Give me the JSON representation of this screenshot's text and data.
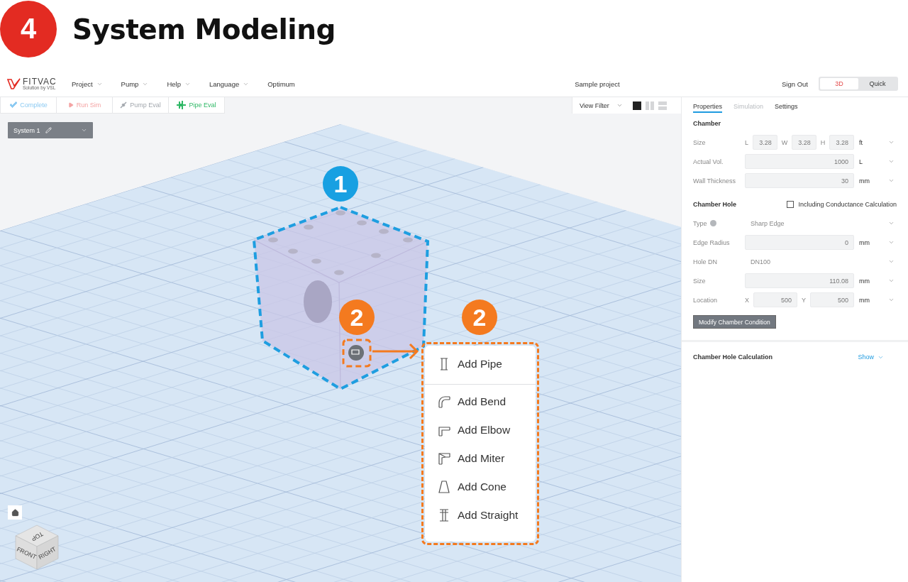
{
  "header": {
    "step": "4",
    "title": "System Modeling"
  },
  "navbar": {
    "logo": {
      "name": "FITVAC",
      "tagline": "Solution by VSL"
    },
    "menu": [
      {
        "label": "Project",
        "dropdown": true
      },
      {
        "label": "Pump",
        "dropdown": true
      },
      {
        "label": "Help",
        "dropdown": true
      },
      {
        "label": "Language",
        "dropdown": true
      },
      {
        "label": "Optimum",
        "dropdown": false
      }
    ],
    "project_name": "Sample project",
    "sign_out": "Sign Out",
    "mode_toggle": [
      {
        "label": "3D",
        "selected": true
      },
      {
        "label": "Quick",
        "selected": false
      }
    ]
  },
  "toolbar": [
    {
      "label": "Complete",
      "kind": "check",
      "color": "#8ccaf2"
    },
    {
      "label": "Run Sim",
      "kind": "play",
      "color": "#f4a3a3"
    },
    {
      "label": "Pump Eval",
      "kind": "pump",
      "color": "#a3a8ae"
    },
    {
      "label": "Pipe Eval",
      "kind": "wave",
      "color": "#2fb866"
    }
  ],
  "view_filter": {
    "label": "View Filter",
    "layouts": [
      {
        "kind": "single",
        "selected": true
      },
      {
        "kind": "columns",
        "selected": false
      },
      {
        "kind": "rows",
        "selected": false
      }
    ]
  },
  "system_selector": {
    "label": "System 1"
  },
  "viewport": {
    "badges": [
      {
        "text": "1",
        "color": "#18a0e2"
      },
      {
        "text": "2",
        "color": "#f47a1f"
      },
      {
        "text": "2",
        "color": "#f47a1f"
      }
    ],
    "context_menu": [
      {
        "label": "Add Pipe",
        "kind": "pipe"
      },
      {
        "label": "Add Bend",
        "kind": "bend"
      },
      {
        "label": "Add Elbow",
        "kind": "elbow"
      },
      {
        "label": "Add Miter",
        "kind": "miter"
      },
      {
        "label": "Add Cone",
        "kind": "cone"
      },
      {
        "label": "Add Straight",
        "kind": "straight"
      }
    ],
    "view_cube": {
      "top": "TOP",
      "front": "FRONT",
      "right": "RIGHT"
    }
  },
  "panel": {
    "tabs": [
      {
        "label": "Properties",
        "selected": true,
        "disabled": false
      },
      {
        "label": "Simulation",
        "selected": false,
        "disabled": true
      },
      {
        "label": "Settings",
        "selected": false,
        "disabled": false
      }
    ],
    "chamber": {
      "title": "Chamber",
      "rows": [
        {
          "kind": "triple",
          "label": "Size",
          "fields": [
            {
              "prefix": "L",
              "value": "3.28"
            },
            {
              "prefix": "W",
              "value": "3.28"
            },
            {
              "prefix": "H",
              "value": "3.28"
            }
          ],
          "unit": "ft"
        },
        {
          "kind": "number",
          "label": "Actual Vol.",
          "value": "1000",
          "unit": "L"
        },
        {
          "kind": "number",
          "label": "Wall Thickness",
          "value": "30",
          "unit": "mm"
        }
      ]
    },
    "chamber_hole": {
      "title": "Chamber Hole",
      "checkbox": {
        "label": "Including Conductance Calculation",
        "checked": false
      },
      "rows": [
        {
          "kind": "select",
          "label": "Type",
          "help": true,
          "value": "Sharp Edge"
        },
        {
          "kind": "number",
          "label": "Edge Radius",
          "value": "0",
          "unit": "mm"
        },
        {
          "kind": "select",
          "label": "Hole DN",
          "help": false,
          "value": "DN100"
        },
        {
          "kind": "number",
          "label": "Size",
          "value": "110.08",
          "unit": "mm"
        },
        {
          "kind": "pair",
          "label": "Location",
          "fields": [
            {
              "prefix": "X",
              "value": "500"
            },
            {
              "prefix": "Y",
              "value": "500"
            }
          ],
          "unit": "mm"
        }
      ],
      "button": "Modify Chamber Condition"
    },
    "calculation": {
      "title": "Chamber Hole Calculation",
      "toggle": "Show"
    }
  }
}
